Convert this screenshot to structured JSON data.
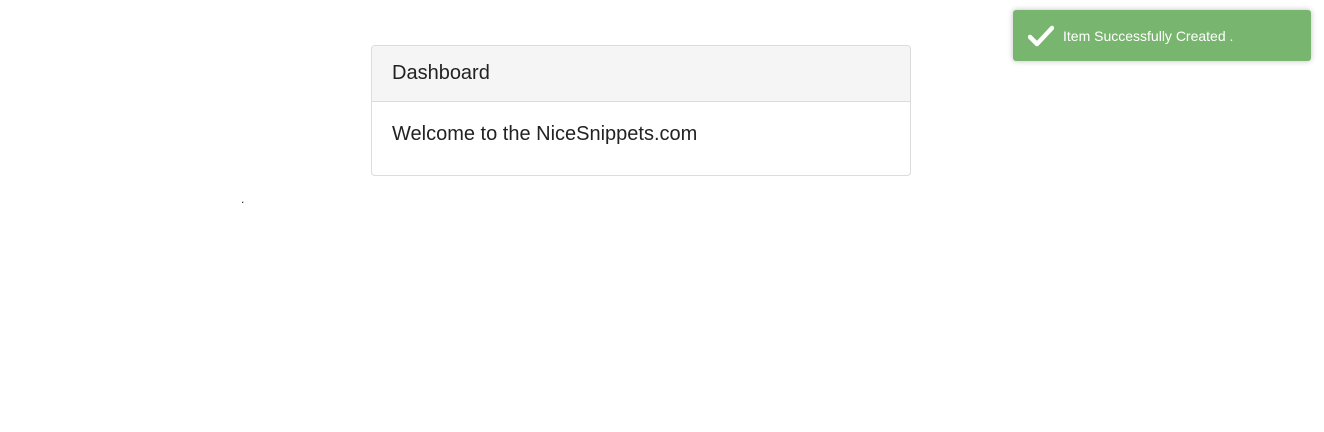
{
  "card": {
    "header_title": "Dashboard",
    "body_text": "Welcome to the NiceSnippets.com"
  },
  "stray_text": ".",
  "toast": {
    "message": "Item Successfully Created .",
    "icon": "checkmark-icon",
    "background_color": "#78b56e",
    "text_color": "#ffffff"
  }
}
